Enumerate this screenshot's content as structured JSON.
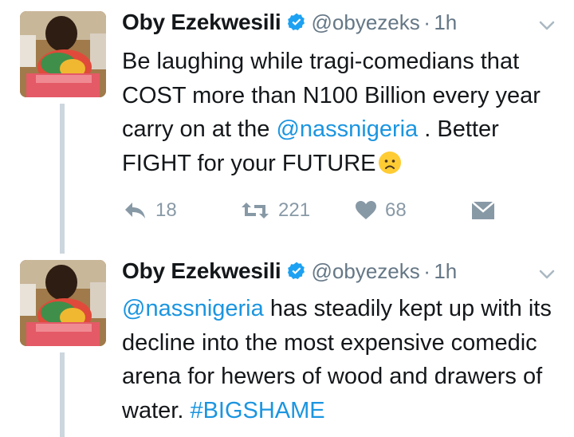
{
  "tweets": [
    {
      "name": "Oby Ezekwesili",
      "handle": "@obyezeks",
      "separator": "·",
      "time": "1h",
      "text_parts": [
        "Be laughing while tragi-comedians that COST more than N100 Billion every year carry on at the ",
        "@nassnigeria",
        " . Better FIGHT for your FUTURE"
      ],
      "emoji": "worried-face",
      "actions": {
        "reply_count": "18",
        "retweet_count": "221",
        "like_count": "68"
      }
    },
    {
      "name": "Oby Ezekwesili",
      "handle": "@obyezeks",
      "separator": "·",
      "time": "1h",
      "text_parts": [
        "@nassnigeria",
        " has steadily kept up with its decline into the most expensive comedic arena for hewers of wood and drawers of water. ",
        "#BIGSHAME"
      ]
    }
  ],
  "colors": {
    "link": "#1b95e0",
    "verified": "#1da1f2",
    "muted": "#8899a6",
    "thread_line": "#ccd6dd"
  }
}
